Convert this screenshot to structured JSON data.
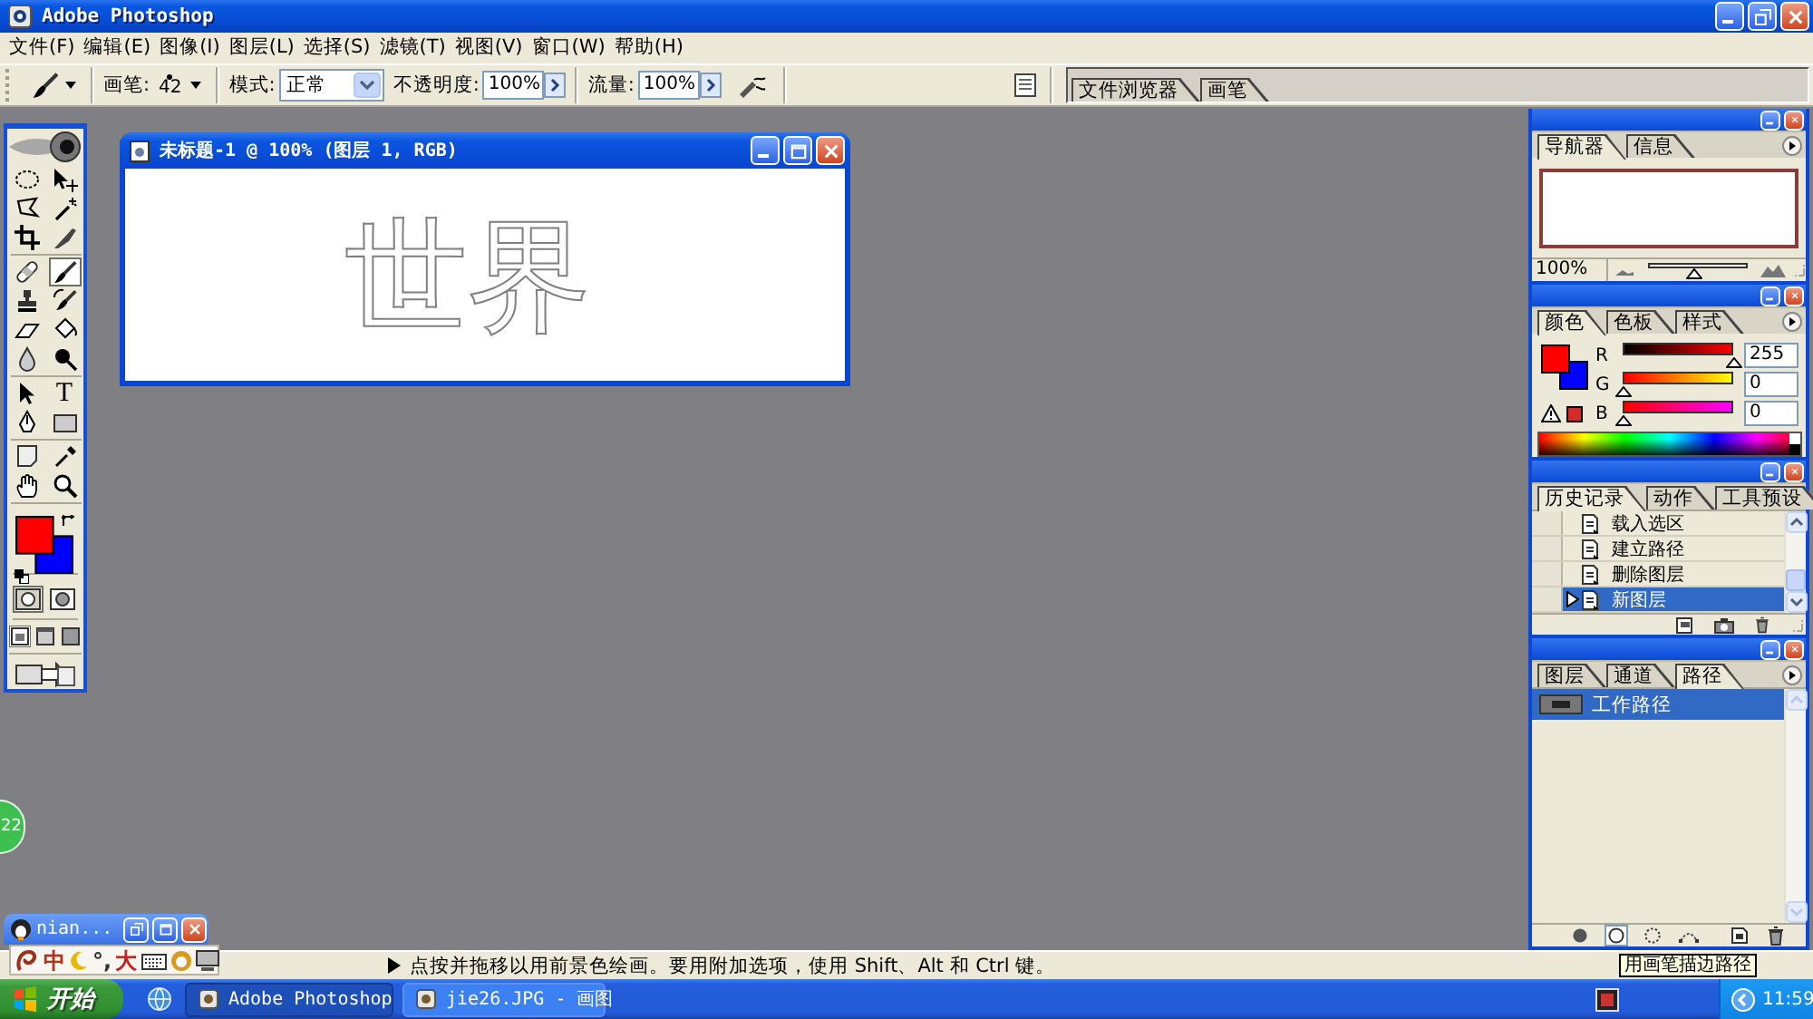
{
  "window": {
    "title": "Adobe Photoshop"
  },
  "menu": [
    {
      "label": "文件(F)"
    },
    {
      "label": "编辑(E)"
    },
    {
      "label": "图像(I)"
    },
    {
      "label": "图层(L)"
    },
    {
      "label": "选择(S)"
    },
    {
      "label": "滤镜(T)"
    },
    {
      "label": "视图(V)"
    },
    {
      "label": "窗口(W)"
    },
    {
      "label": "帮助(H)"
    }
  ],
  "options_bar": {
    "brush_label": "画笔:",
    "brush_size": "42",
    "mode_label": "模式:",
    "mode": "正常",
    "opacity_label": "不透明度:",
    "opacity": "100%",
    "flow_label": "流量:",
    "flow": "100%"
  },
  "palette_well": {
    "tabs": [
      {
        "label": "文件浏览器",
        "selected": false
      },
      {
        "label": "画笔",
        "selected": false
      }
    ]
  },
  "toolbox": {
    "tool_groups": [
      [
        {
          "kind": "ellipse_marquee",
          "selected": false
        },
        {
          "kind": "move",
          "selected": false
        },
        {
          "kind": "lasso",
          "selected": false
        },
        {
          "kind": "magic_wand",
          "selected": false
        },
        {
          "kind": "crop",
          "selected": false
        },
        {
          "kind": "slice",
          "selected": false
        }
      ],
      [
        {
          "kind": "healing",
          "selected": false
        },
        {
          "kind": "brush",
          "selected": true
        },
        {
          "kind": "stamp",
          "selected": false
        },
        {
          "kind": "history_brush",
          "selected": false
        },
        {
          "kind": "eraser",
          "selected": false
        },
        {
          "kind": "bucket",
          "selected": false
        },
        {
          "kind": "blur",
          "selected": false
        },
        {
          "kind": "burn",
          "selected": false
        }
      ],
      [
        {
          "kind": "path_select",
          "selected": false
        },
        {
          "kind": "type",
          "glyph": "T",
          "selected": false
        },
        {
          "kind": "pen",
          "selected": false
        },
        {
          "kind": "shape",
          "selected": false
        }
      ],
      [
        {
          "kind": "notes",
          "selected": false
        },
        {
          "kind": "eyedropper",
          "selected": false
        },
        {
          "kind": "hand",
          "selected": false
        },
        {
          "kind": "zoom",
          "selected": false
        }
      ]
    ],
    "swatches": [
      {
        "kind": "foreground",
        "color": "#ff0000"
      },
      {
        "kind": "background",
        "color": "#0000ff"
      }
    ],
    "mask_modes": [
      {
        "kind": "standard",
        "selected": true
      },
      {
        "kind": "quick_mask",
        "selected": false
      }
    ],
    "screen_modes": [
      {
        "kind": "standard_window",
        "selected": true
      },
      {
        "kind": "full_menu",
        "selected": false
      },
      {
        "kind": "full_screen",
        "selected": false
      }
    ]
  },
  "document": {
    "title": "未标题-1 @ 100% (图层 1, RGB)",
    "canvas_text": "世界"
  },
  "navigator": {
    "tabs": [
      {
        "label": "导航器",
        "selected": true
      },
      {
        "label": "信息",
        "selected": false
      }
    ],
    "zoom": "100%",
    "zoom_slider": {
      "level": 0.45
    }
  },
  "color": {
    "tabs": [
      {
        "label": "颜色",
        "selected": true
      },
      {
        "label": "色板",
        "selected": false
      },
      {
        "label": "样式",
        "selected": false
      }
    ],
    "foreground": {
      "color": "#ff0000"
    },
    "background": {
      "color": "#0000ff"
    },
    "channels": [
      {
        "name": "R",
        "value": "255",
        "level": 1
      },
      {
        "name": "G",
        "value": "0",
        "level": 0
      },
      {
        "name": "B",
        "value": "0",
        "level": 0
      }
    ],
    "gamut_warning": {
      "shown": true,
      "color": "#d62a2a"
    }
  },
  "history": {
    "tabs": [
      {
        "label": "历史记录",
        "selected": true
      },
      {
        "label": "动作",
        "selected": false
      },
      {
        "label": "工具预设",
        "selected": false
      }
    ],
    "steps": [
      {
        "label": "载入选区",
        "selected": false
      },
      {
        "label": "建立路径",
        "selected": false
      },
      {
        "label": "删除图层",
        "selected": false
      },
      {
        "label": "新图层",
        "selected": true
      }
    ]
  },
  "paths": {
    "tabs": [
      {
        "label": "图层",
        "selected": false
      },
      {
        "label": "通道",
        "selected": false
      },
      {
        "label": "路径",
        "selected": true
      }
    ],
    "items": [
      {
        "label": "工作路径",
        "selected": true
      }
    ],
    "actions": [
      {
        "kind": "fill",
        "pressed": false
      },
      {
        "kind": "stroke",
        "pressed": true
      },
      {
        "kind": "load",
        "pressed": false
      },
      {
        "kind": "work_path",
        "pressed": false
      },
      {
        "kind": "new",
        "pressed": false
      },
      {
        "kind": "delete",
        "pressed": false
      }
    ]
  },
  "tooltip": {
    "text": "用画笔描边路径"
  },
  "status_bar": {
    "text": "点按并拖移以用前景色绘画。要用附加选项，使用 Shift、Alt 和 Ctrl 键。"
  },
  "ime_window": {
    "title": "nian..."
  },
  "ime_bar": {
    "language": "中",
    "punctuation": "°,",
    "width": "大"
  },
  "badge": {
    "text": "22"
  },
  "taskbar": {
    "start": "开始",
    "tasks": [
      {
        "label": "Adobe Photoshop",
        "selected": true
      },
      {
        "label": "jie26.JPG - 画图",
        "selected": false
      }
    ],
    "clock": "11:59"
  }
}
